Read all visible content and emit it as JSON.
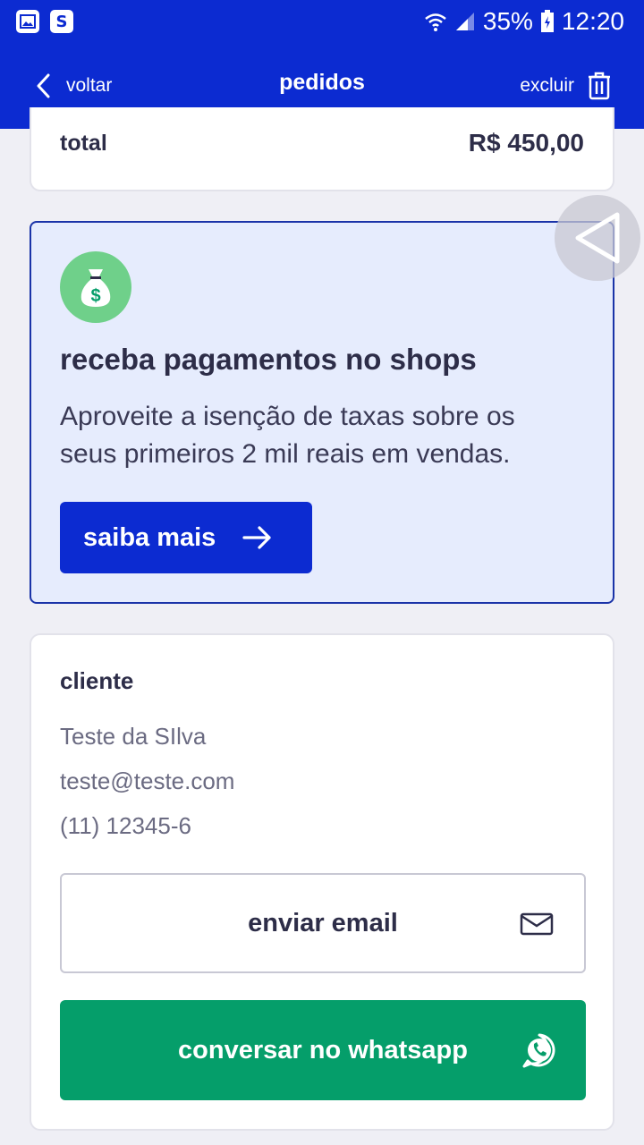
{
  "status_bar": {
    "battery": "35%",
    "time": "12:20",
    "left_icons": [
      "gallery-icon",
      "s-app-icon"
    ],
    "right_icons": [
      "wifi-icon",
      "signal-icon",
      "battery-icon"
    ]
  },
  "header": {
    "back_label": "voltar",
    "title": "pedidos",
    "delete_label": "excluir"
  },
  "order": {
    "total_label": "total",
    "total_value": "R$ 450,00"
  },
  "promo": {
    "title": "receba pagamentos no shops",
    "text": "Aproveite a isenção de taxas sobre os seus primeiros 2 mil reais em vendas.",
    "button_label": "saiba mais",
    "icon": "money-bag-icon"
  },
  "client": {
    "title": "cliente",
    "name": "Teste da SIlva",
    "email": "teste@teste.com",
    "phone": "(11) 12345-6",
    "email_button": "enviar email",
    "whatsapp_button": "conversar no whatsapp"
  },
  "colors": {
    "primary": "#0c2bd1",
    "whatsapp": "#059e6a",
    "promo_bg": "#e6ecfd",
    "money_icon_bg": "#6fd08a"
  }
}
